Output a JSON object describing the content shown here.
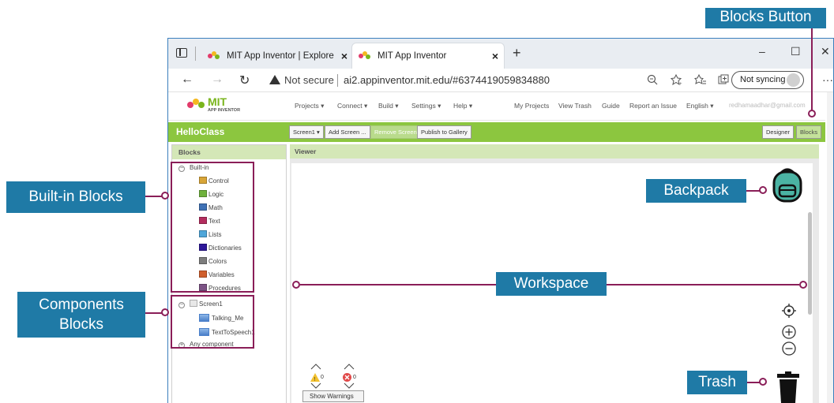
{
  "browser": {
    "tabs": [
      {
        "title": "MIT App Inventor | Explore MIT A"
      },
      {
        "title": "MIT App Inventor"
      }
    ],
    "close_glyph": "×",
    "newtab_glyph": "+",
    "window_controls": [
      "–",
      "☐",
      "✕"
    ],
    "nav": {
      "back": "←",
      "forward": "→",
      "reload": "↻"
    },
    "security": "Not secure",
    "url": "ai2.appinventor.mit.edu/#6374419059834880",
    "sync_label": "Not syncing",
    "menu": "···",
    "icons": [
      "zoom-icon",
      "favorites-add-icon",
      "favorites-icon",
      "collections-icon"
    ]
  },
  "app": {
    "logo_title": "MIT",
    "logo_sub": "APP INVENTOR",
    "menus": [
      "Projects ▾",
      "Connect ▾",
      "Build ▾",
      "Settings ▾",
      "Help ▾"
    ],
    "links": [
      "My Projects",
      "View Trash",
      "Guide",
      "Report an Issue",
      "English ▾"
    ],
    "user_email": "redhamaadhar@gmail.com",
    "project_name": "HelloClass",
    "toolbar": {
      "screen": "Screen1 ▾",
      "add_screen": "Add Screen ...",
      "remove_screen": "Remove Screen",
      "publish": "Publish to Gallery",
      "designer": "Designer",
      "blocks": "Blocks"
    },
    "blocks_panel": {
      "header": "Blocks",
      "builtin_label": "Built-in",
      "builtin": [
        {
          "label": "Control",
          "color": "#d8a537"
        },
        {
          "label": "Logic",
          "color": "#6fb13d"
        },
        {
          "label": "Math",
          "color": "#3f71b5"
        },
        {
          "label": "Text",
          "color": "#b32d5e"
        },
        {
          "label": "Lists",
          "color": "#4fa6d9"
        },
        {
          "label": "Dictionaries",
          "color": "#2d1799"
        },
        {
          "label": "Colors",
          "color": "#7d7d7d"
        },
        {
          "label": "Variables",
          "color": "#d05f2d"
        },
        {
          "label": "Procedures",
          "color": "#7c5385"
        }
      ],
      "screen_label": "Screen1",
      "components": [
        "Talking_Me",
        "TextToSpeech1"
      ],
      "any_component": "Any component"
    },
    "viewer": {
      "header": "Viewer",
      "warning_count": "0",
      "error_count": "0",
      "show_warnings": "Show Warnings"
    }
  },
  "callouts": {
    "blocks_button": "Blocks Button",
    "builtin_blocks": "Built-in Blocks",
    "components_blocks": "Components Blocks",
    "backpack": "Backpack",
    "workspace": "Workspace",
    "trash": "Trash"
  },
  "colors": {
    "callout_bg": "#1f7aa6",
    "callout_line": "#8a1e58",
    "green_bar": "#8cc63f",
    "panel_header": "#d4e7b7"
  }
}
